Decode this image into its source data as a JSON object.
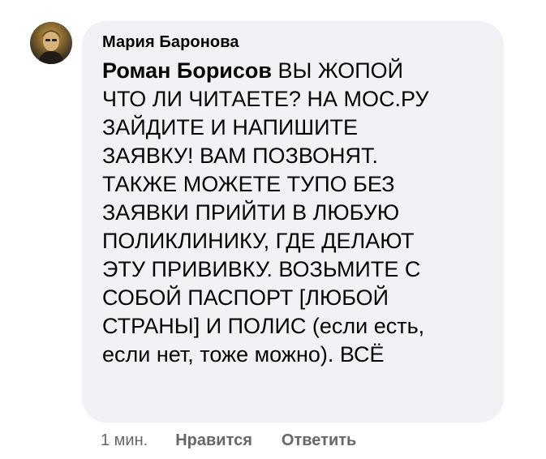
{
  "comment": {
    "author": "Мария Баронова",
    "mention": "Роман Борисов",
    "text": " ВЫ ЖОПОЙ\nЧТО ЛИ ЧИТАЕТЕ? НА МОС.РУ\nЗАЙДИТЕ И НАПИШИТЕ\nЗАЯВКУ! ВАМ ПОЗВОНЯТ.\nТАКЖЕ МОЖЕТЕ ТУПО БЕЗ\nЗАЯВКИ ПРИЙТИ В ЛЮБУЮ\nПОЛИКЛИНИКУ, ГДЕ ДЕЛАЮТ\nЭТУ ПРИВИВКУ. ВОЗЬМИТЕ С\nСОБОЙ ПАСПОРТ [ЛЮБОЙ\nСТРАНЫ] И ПОЛИС (если есть,\nесли нет, тоже можно). ВСЁ"
  },
  "meta": {
    "time": "1 мин.",
    "like_label": "Нравится",
    "reply_label": "Ответить"
  },
  "colors": {
    "bubble": "#f0f2f5",
    "text": "#050505",
    "meta": "#65676b"
  },
  "icons": {
    "avatar": "user-avatar"
  }
}
